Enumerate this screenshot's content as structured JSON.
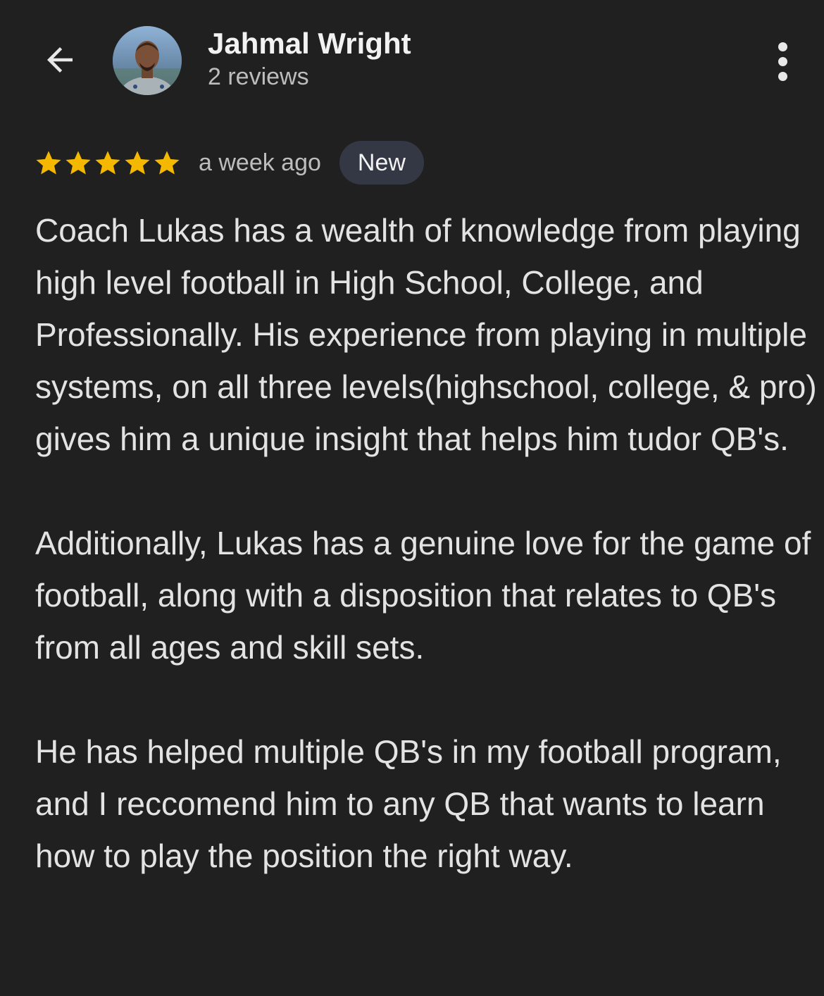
{
  "header": {
    "back_icon": "arrow-back-icon",
    "user_name": "Jahmal Wright",
    "review_count": "2 reviews",
    "menu_icon": "more-vertical-icon"
  },
  "review": {
    "rating": 5,
    "rating_max": 5,
    "star_color": "#f5b800",
    "time_ago": "a week ago",
    "badge": "New",
    "paragraphs": [
      "Coach Lukas has a wealth of knowledge from playing high level football in High School, College, and Professionally. His experience from playing in multiple systems, on all three levels(highschool, college, & pro) gives him a unique insight that helps him tudor QB's.",
      "Additionally, Lukas has a genuine love for the game of football, along with a disposition that relates to QB's from all ages and skill sets.",
      "He has helped multiple QB's in my football program, and I reccomend him to any QB that wants to learn how to play the position the right way."
    ]
  },
  "colors": {
    "background": "#202020",
    "text": "#e3e3e3",
    "secondary_text": "#bdbdbd",
    "badge_bg": "#333844"
  }
}
